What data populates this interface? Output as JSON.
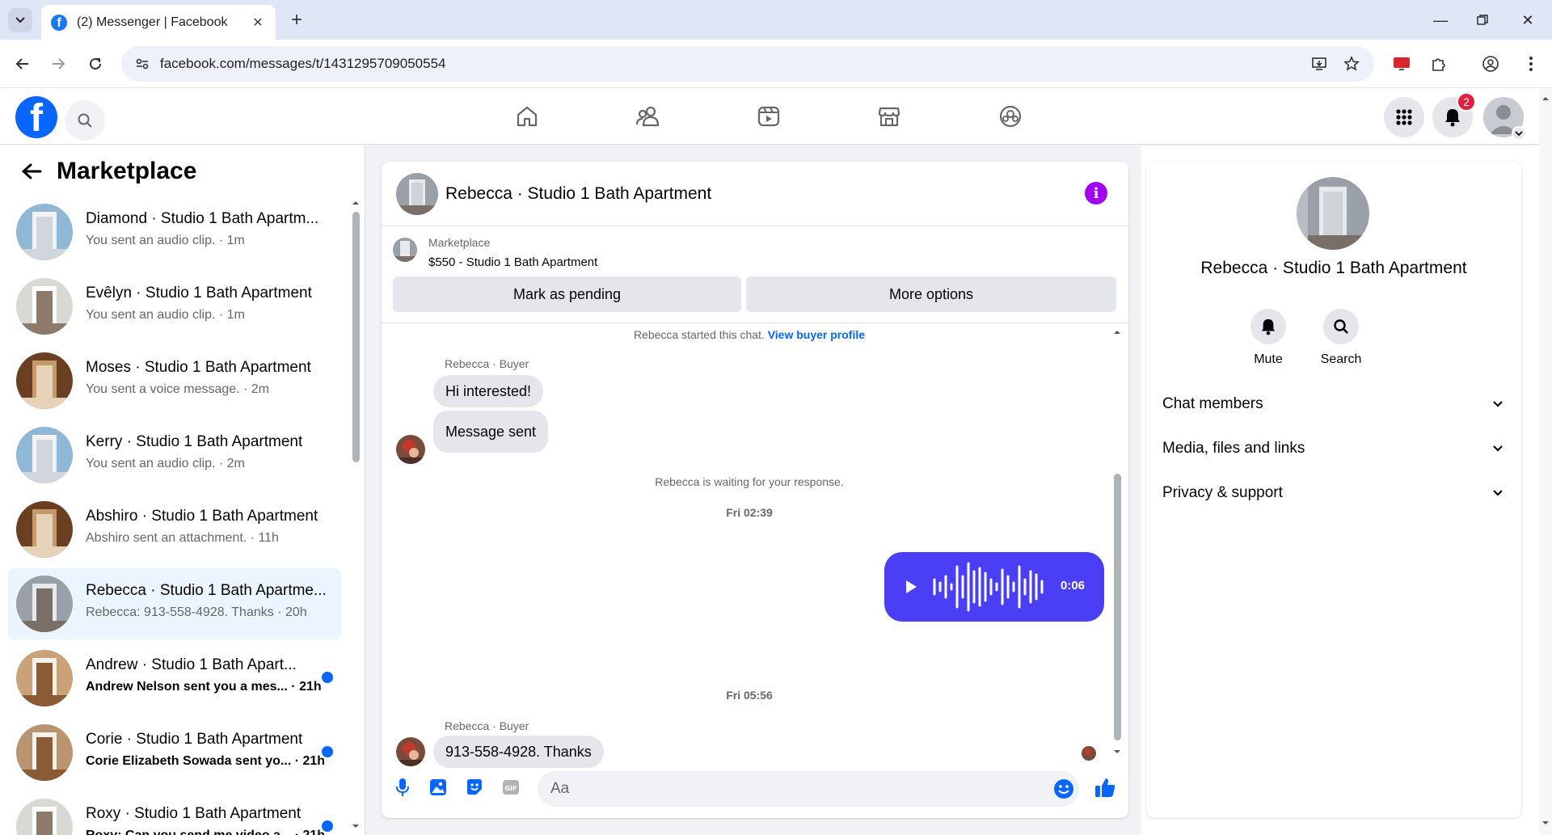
{
  "browser": {
    "tab_title": "(2) Messenger | Facebook",
    "url": "facebook.com/messages/t/1431295709050554"
  },
  "fbnav": {
    "notification_count": "2"
  },
  "sidebar": {
    "title": "Marketplace",
    "conversations": [
      {
        "name": "Diamond · Studio 1 Bath Apartm...",
        "preview": "You sent an audio clip. · 1m",
        "unread": false,
        "active": false
      },
      {
        "name": "Evêlyn · Studio 1 Bath Apartment",
        "preview": "You sent an audio clip. · 1m",
        "unread": false,
        "active": false
      },
      {
        "name": "Moses · Studio 1 Bath Apartment",
        "preview": "You sent a voice message. · 2m",
        "unread": false,
        "active": false
      },
      {
        "name": "Kerry · Studio 1 Bath Apartment",
        "preview": "You sent an audio clip. · 2m",
        "unread": false,
        "active": false
      },
      {
        "name": "Abshiro · Studio 1 Bath Apartment",
        "preview": "Abshiro sent an attachment. · 11h",
        "unread": false,
        "active": false
      },
      {
        "name": "Rebecca · Studio 1 Bath Apartme...",
        "preview": "Rebecca: 913-558-4928. Thanks · 20h",
        "unread": false,
        "active": true
      },
      {
        "name": "Andrew · Studio 1 Bath Apart...",
        "preview": "Andrew Nelson sent you a mes... · 21h",
        "unread": true,
        "active": false
      },
      {
        "name": "Corie · Studio 1 Bath Apartment",
        "preview": "Corie Elizabeth Sowada sent yo... · 21h",
        "unread": true,
        "active": false
      },
      {
        "name": "Roxy · Studio 1 Bath Apartment",
        "preview": "Roxy: Can you send me video a... · 21h",
        "unread": true,
        "active": false
      }
    ]
  },
  "chat": {
    "header_name": "Rebecca · Studio 1 Bath Apartment",
    "marketplace_label": "Marketplace",
    "listing": "$550 - Studio 1 Bath Apartment",
    "mark_pending": "Mark as pending",
    "more_options": "More options",
    "started_text": "Rebecca started this chat.",
    "view_buyer": "View buyer profile",
    "sender_label_1": "Rebecca · Buyer",
    "msg_1": "Hi interested!",
    "msg_2": "Message sent",
    "waiting": "Rebecca is waiting for your response.",
    "ts_1": "Fri 02:39",
    "voice_duration": "0:06",
    "ts_2": "Fri 05:56",
    "sender_label_2": "Rebecca · Buyer",
    "msg_3": "913-558-4928. Thanks",
    "composer_placeholder": "Aa",
    "accent": "#0866ff",
    "voice_color": "#4a3ff5"
  },
  "info": {
    "name": "Rebecca · Studio 1 Bath Apartment",
    "mute": "Mute",
    "search": "Search",
    "rows": [
      "Chat members",
      "Media, files and links",
      "Privacy & support"
    ]
  }
}
